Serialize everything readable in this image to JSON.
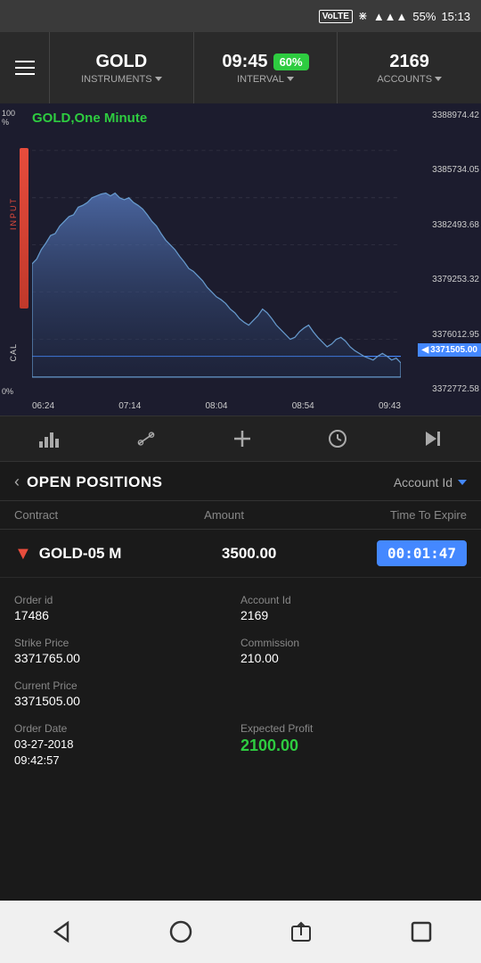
{
  "statusBar": {
    "network": "VoLTE",
    "battery": "55%",
    "time": "15:13"
  },
  "header": {
    "menuLabel": "menu",
    "instrument": {
      "name": "GOLD",
      "subLabel": "INSTRUMENTS"
    },
    "interval": {
      "time": "09:45",
      "badge": "60%",
      "subLabel": "INTERVAL"
    },
    "accounts": {
      "value": "2169",
      "subLabel": "ACCOUNTS"
    }
  },
  "chart": {
    "title": "GOLD,One Minute",
    "yAxisLabels": [
      "100%",
      "0%"
    ],
    "xAxisTimes": [
      "06:24",
      "07:14",
      "08:04",
      "08:54",
      "09:43"
    ],
    "priceLabels": [
      "3388974.42",
      "3385734.05",
      "3382493.68",
      "3379253.32",
      "3376012.95",
      "3372772.58"
    ],
    "currentPrice": "3371505.00",
    "sideLabels": {
      "input": "INPUT",
      "cal": "CAL"
    }
  },
  "toolbar": {
    "buttons": [
      "chart-icon",
      "cursor-icon",
      "plus-icon",
      "clock-icon",
      "skip-end-icon"
    ]
  },
  "positions": {
    "title": "OPEN POSITIONS",
    "accountIdLabel": "Account Id",
    "tableHeaders": {
      "contract": "Contract",
      "amount": "Amount",
      "timeToExpire": "Time To Expire"
    },
    "row": {
      "direction": "down",
      "name": "GOLD-05 M",
      "amount": "3500.00",
      "timer": "00:01:47"
    },
    "details": {
      "orderId": {
        "label": "Order id",
        "value": "17486"
      },
      "accountId": {
        "label": "Account Id",
        "value": "2169"
      },
      "strikePrice": {
        "label": "Strike Price",
        "value": "3371765.00"
      },
      "commission": {
        "label": "Commission",
        "value": "210.00"
      },
      "currentPrice": {
        "label": "Current Price",
        "value": "3371505.00"
      },
      "orderDate": {
        "label": "Order Date",
        "value": "03-27-2018\n09:42:57"
      },
      "expectedProfit": {
        "label": "Expected Profit",
        "value": "2100.00"
      }
    }
  },
  "bottomNav": {
    "buttons": [
      "back-icon",
      "home-icon",
      "share-icon",
      "square-icon"
    ]
  }
}
